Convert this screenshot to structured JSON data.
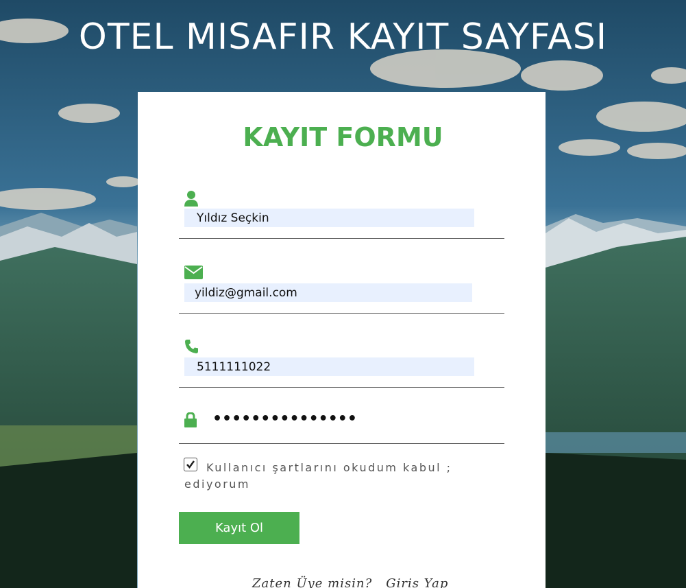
{
  "page": {
    "title": "OTEL MISAFIR KAYIT SAYFASI"
  },
  "form": {
    "title": "KAYIT FORMU",
    "name_value": "Yıldız Seçkin",
    "email_value": "yildiz@gmail.com",
    "phone_value": "5111111022",
    "password_mask": "•••••••••••••••",
    "terms_checked": true,
    "terms_label": "Kullanıcı şartlarını okudum kabul ; ediyorum",
    "submit_label": "Kayıt Ol",
    "already_member_text": "Zaten Üye misin?",
    "login_link": "Giris Yap"
  },
  "icons": {
    "name": "user-icon",
    "email": "envelope-icon",
    "phone": "phone-icon",
    "password": "lock-icon",
    "checkbox": "checkmark-icon"
  },
  "colors": {
    "accent": "#4caf50",
    "input_bg": "#e8f0fe",
    "card_bg": "#ffffff",
    "title": "#ffffff"
  }
}
